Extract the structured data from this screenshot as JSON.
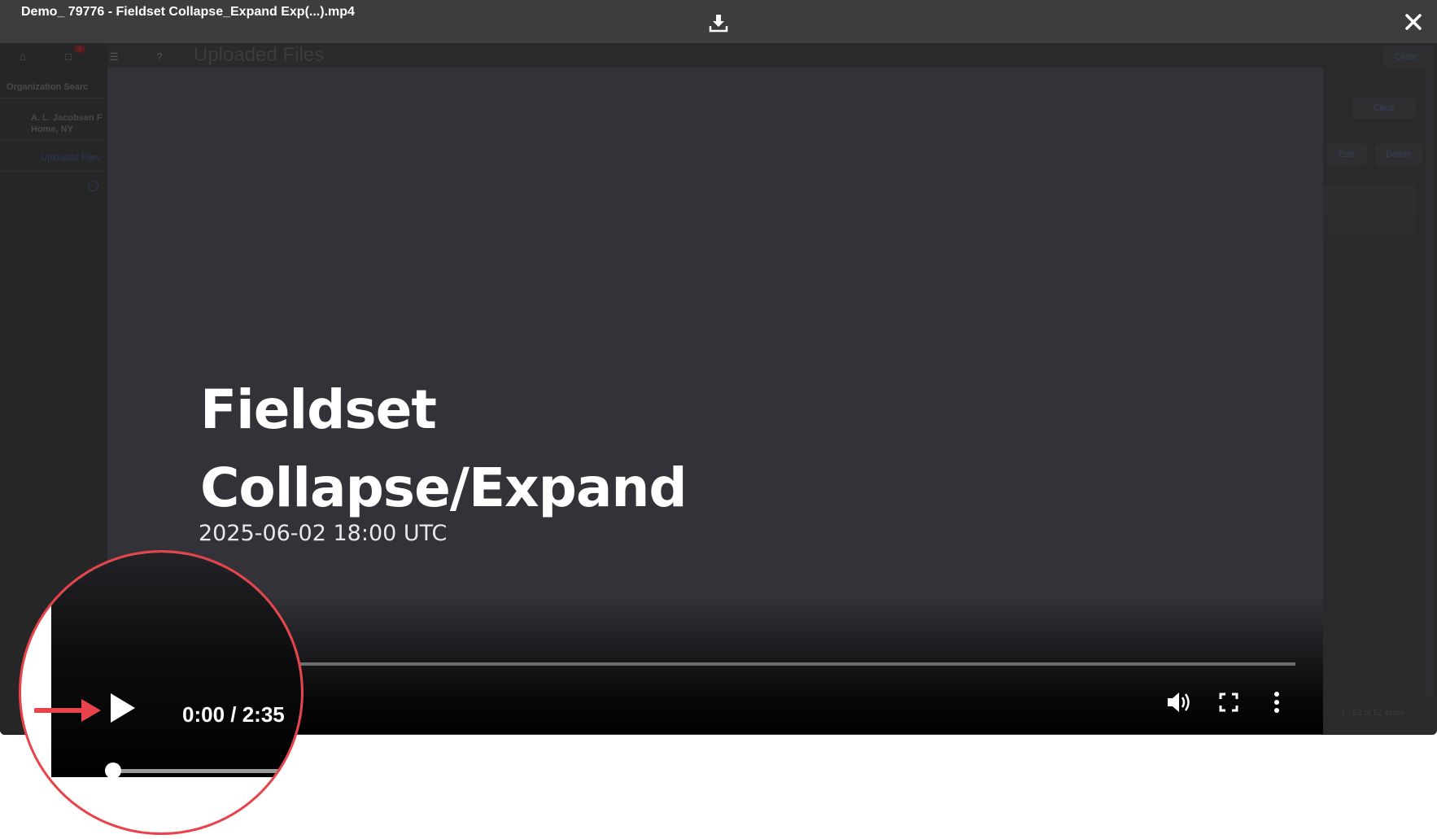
{
  "viewer": {
    "file_title": "Demo_ 79776 - Fieldset Collapse_Expand  Exp(...).mp4",
    "download_icon": "download-icon",
    "close_icon": "close-icon"
  },
  "background_app": {
    "page_title": "Uploaded Files",
    "notification_badge": "1",
    "sidebar_section": "Organization Searc",
    "org_name_line1": "A. L. Jacobsen F",
    "org_name_line2": "Home, NY",
    "sidebar_link": "Uploaded Files",
    "close_label": "Close",
    "clear_label": "Clear",
    "edit_label": "Edit",
    "delete_label": "Delete",
    "pager_text": "1 - 52 of 52 items"
  },
  "video": {
    "slide_title_line1": "Fieldset",
    "slide_title_line2": "Collapse/Expand",
    "slide_date": "2025-06-02 18:00 UTC",
    "current_time": "0:00",
    "duration": "2:35",
    "time_display": "0:00 / 2:35",
    "progress": 0,
    "controls": [
      "play-icon",
      "volume-icon",
      "fullscreen-icon",
      "more-options-icon"
    ]
  },
  "callout": {
    "time_display": "0:00 / 2:35",
    "border_color": "#e8434a",
    "arrow_color": "#e8434a"
  }
}
